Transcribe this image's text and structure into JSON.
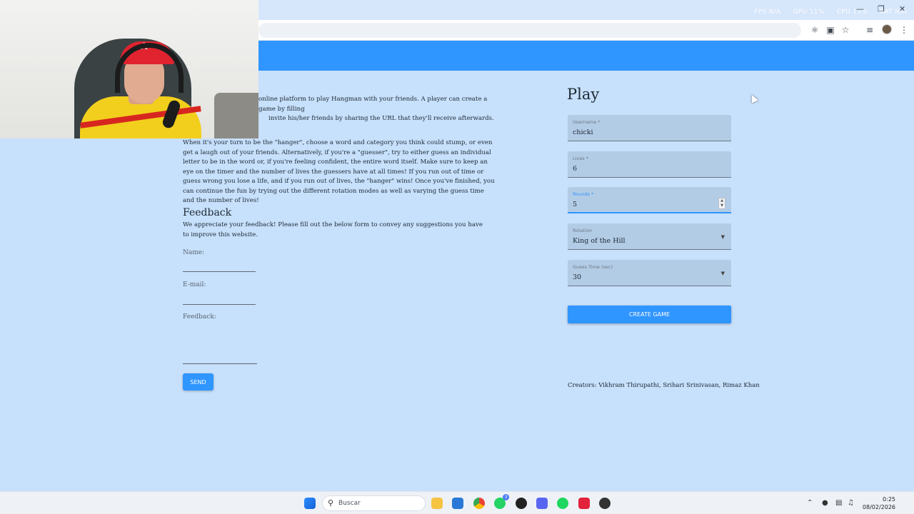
{
  "browser": {
    "perf": [
      "FPS N/A",
      "GPU 11%",
      "CPU 13%",
      "RAT N/A"
    ]
  },
  "intro": {
    "line1": "online platform to play Hangman with your friends. A player can create a game by filling",
    "line2": "invite his/her friends by sharing the URL that they'll receive afterwards."
  },
  "rules_text": "When it's your turn to be the \"hanger\", choose a word and category you think could stump, or even get a laugh out of your friends. Alternatively, if you're a \"guesser\", try to either guess an individual letter to be in the word or, if you're feeling confident, the entire word itself. Make sure to keep an eye on the timer and the number of lives the guessers have at all times! If you run out of time or guess wrong you lose a life, and if you run out of lives, the \"hanger\" wins! Once you've finished, you can continue the fun by trying out the different rotation modes as well as varying the guess time and the number of lives!",
  "feedback": {
    "title": "Feedback",
    "description": "We appreciate your feedback! Please fill out the below form to convey any suggestions you have to improve this website.",
    "name_label": "Name:",
    "email_label": "E-mail:",
    "feedback_label": "Feedback:",
    "send_label": "SEND"
  },
  "play": {
    "title": "Play",
    "fields": {
      "username": {
        "label": "Username *",
        "value": "chicki"
      },
      "lives": {
        "label": "Lives *",
        "value": "6"
      },
      "rounds": {
        "label": "Rounds *",
        "value": "5"
      },
      "rotation": {
        "label": "Rotation",
        "value": "King of the Hill"
      },
      "guess_time": {
        "label": "Guess Time (sec)",
        "value": "30"
      }
    },
    "create_label": "CREATE GAME"
  },
  "creators": "Creators: Vikhram Thirupathi, Srihari Srinivasan, Rimaz Khan",
  "taskbar": {
    "search_placeholder": "Buscar",
    "time": "0:25",
    "date": "08/02/2026",
    "whatsapp_badge": "3"
  },
  "colors": {
    "accent": "#2f95ff",
    "page_background": "#c7e0fb",
    "field_background": "#b3cce6"
  }
}
